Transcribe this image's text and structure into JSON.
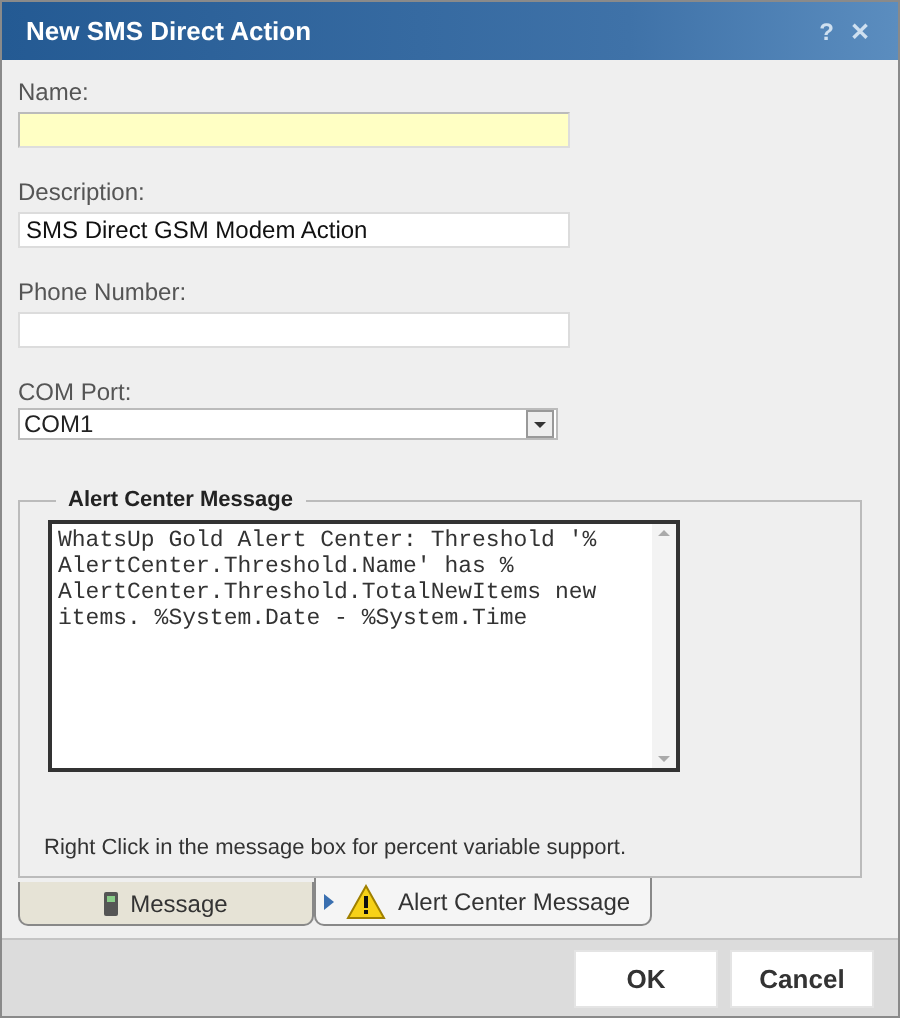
{
  "window": {
    "title": "New SMS Direct Action",
    "help": "?",
    "close": "✕"
  },
  "fields": [
    {
      "kind": "text",
      "label": "Name:",
      "required": true
    },
    {
      "kind": "text",
      "label": "Description:",
      "value": "SMS Direct GSM Modem Action",
      "required": false
    },
    {
      "kind": "text",
      "label": "Phone Number:",
      "required": false
    },
    {
      "kind": "select",
      "label": "COM Port:",
      "value": "COM1"
    }
  ],
  "message_group": {
    "title": "Alert Center Message",
    "message": "WhatsUp Gold Alert Center: Threshold '%\nAlertCenter.Threshold.Name' has %\nAlertCenter.Threshold.TotalNewItems new\nitems. %System.Date - %System.Time",
    "hint": "Right Click in the message box for percent variable support."
  },
  "tabs": [
    {
      "label": "Message",
      "kind": "phone",
      "selected": false
    },
    {
      "label": "Alert Center Message",
      "kind": "warning",
      "selected": true
    }
  ],
  "buttons": [
    "OK",
    "Cancel"
  ]
}
